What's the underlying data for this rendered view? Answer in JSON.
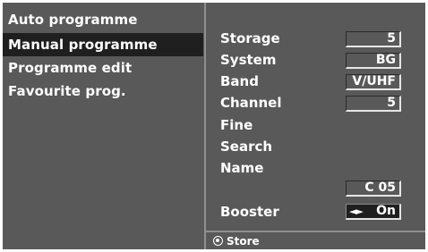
{
  "menu": {
    "items": [
      {
        "label": "Auto programme"
      },
      {
        "label": "Manual programme",
        "selected": true
      },
      {
        "label": "Programme edit"
      },
      {
        "label": "Favourite prog."
      }
    ]
  },
  "panel": {
    "storage": {
      "label": "Storage",
      "value": "5"
    },
    "system": {
      "label": "System",
      "value": "BG"
    },
    "band": {
      "label": "Band",
      "value": "V/UHF"
    },
    "channel": {
      "label": "Channel",
      "value": "5"
    },
    "fine": {
      "label": "Fine"
    },
    "search": {
      "label": "Search"
    },
    "name": {
      "label": "Name",
      "value": "C 05"
    },
    "booster": {
      "label": "Booster",
      "arrows": "◄►",
      "value": "On"
    }
  },
  "footer": {
    "store_label": "Store",
    "icon": "store-icon"
  },
  "colors": {
    "background": "#595959",
    "selected": "#1f1f1f",
    "text": "#ffffff"
  }
}
